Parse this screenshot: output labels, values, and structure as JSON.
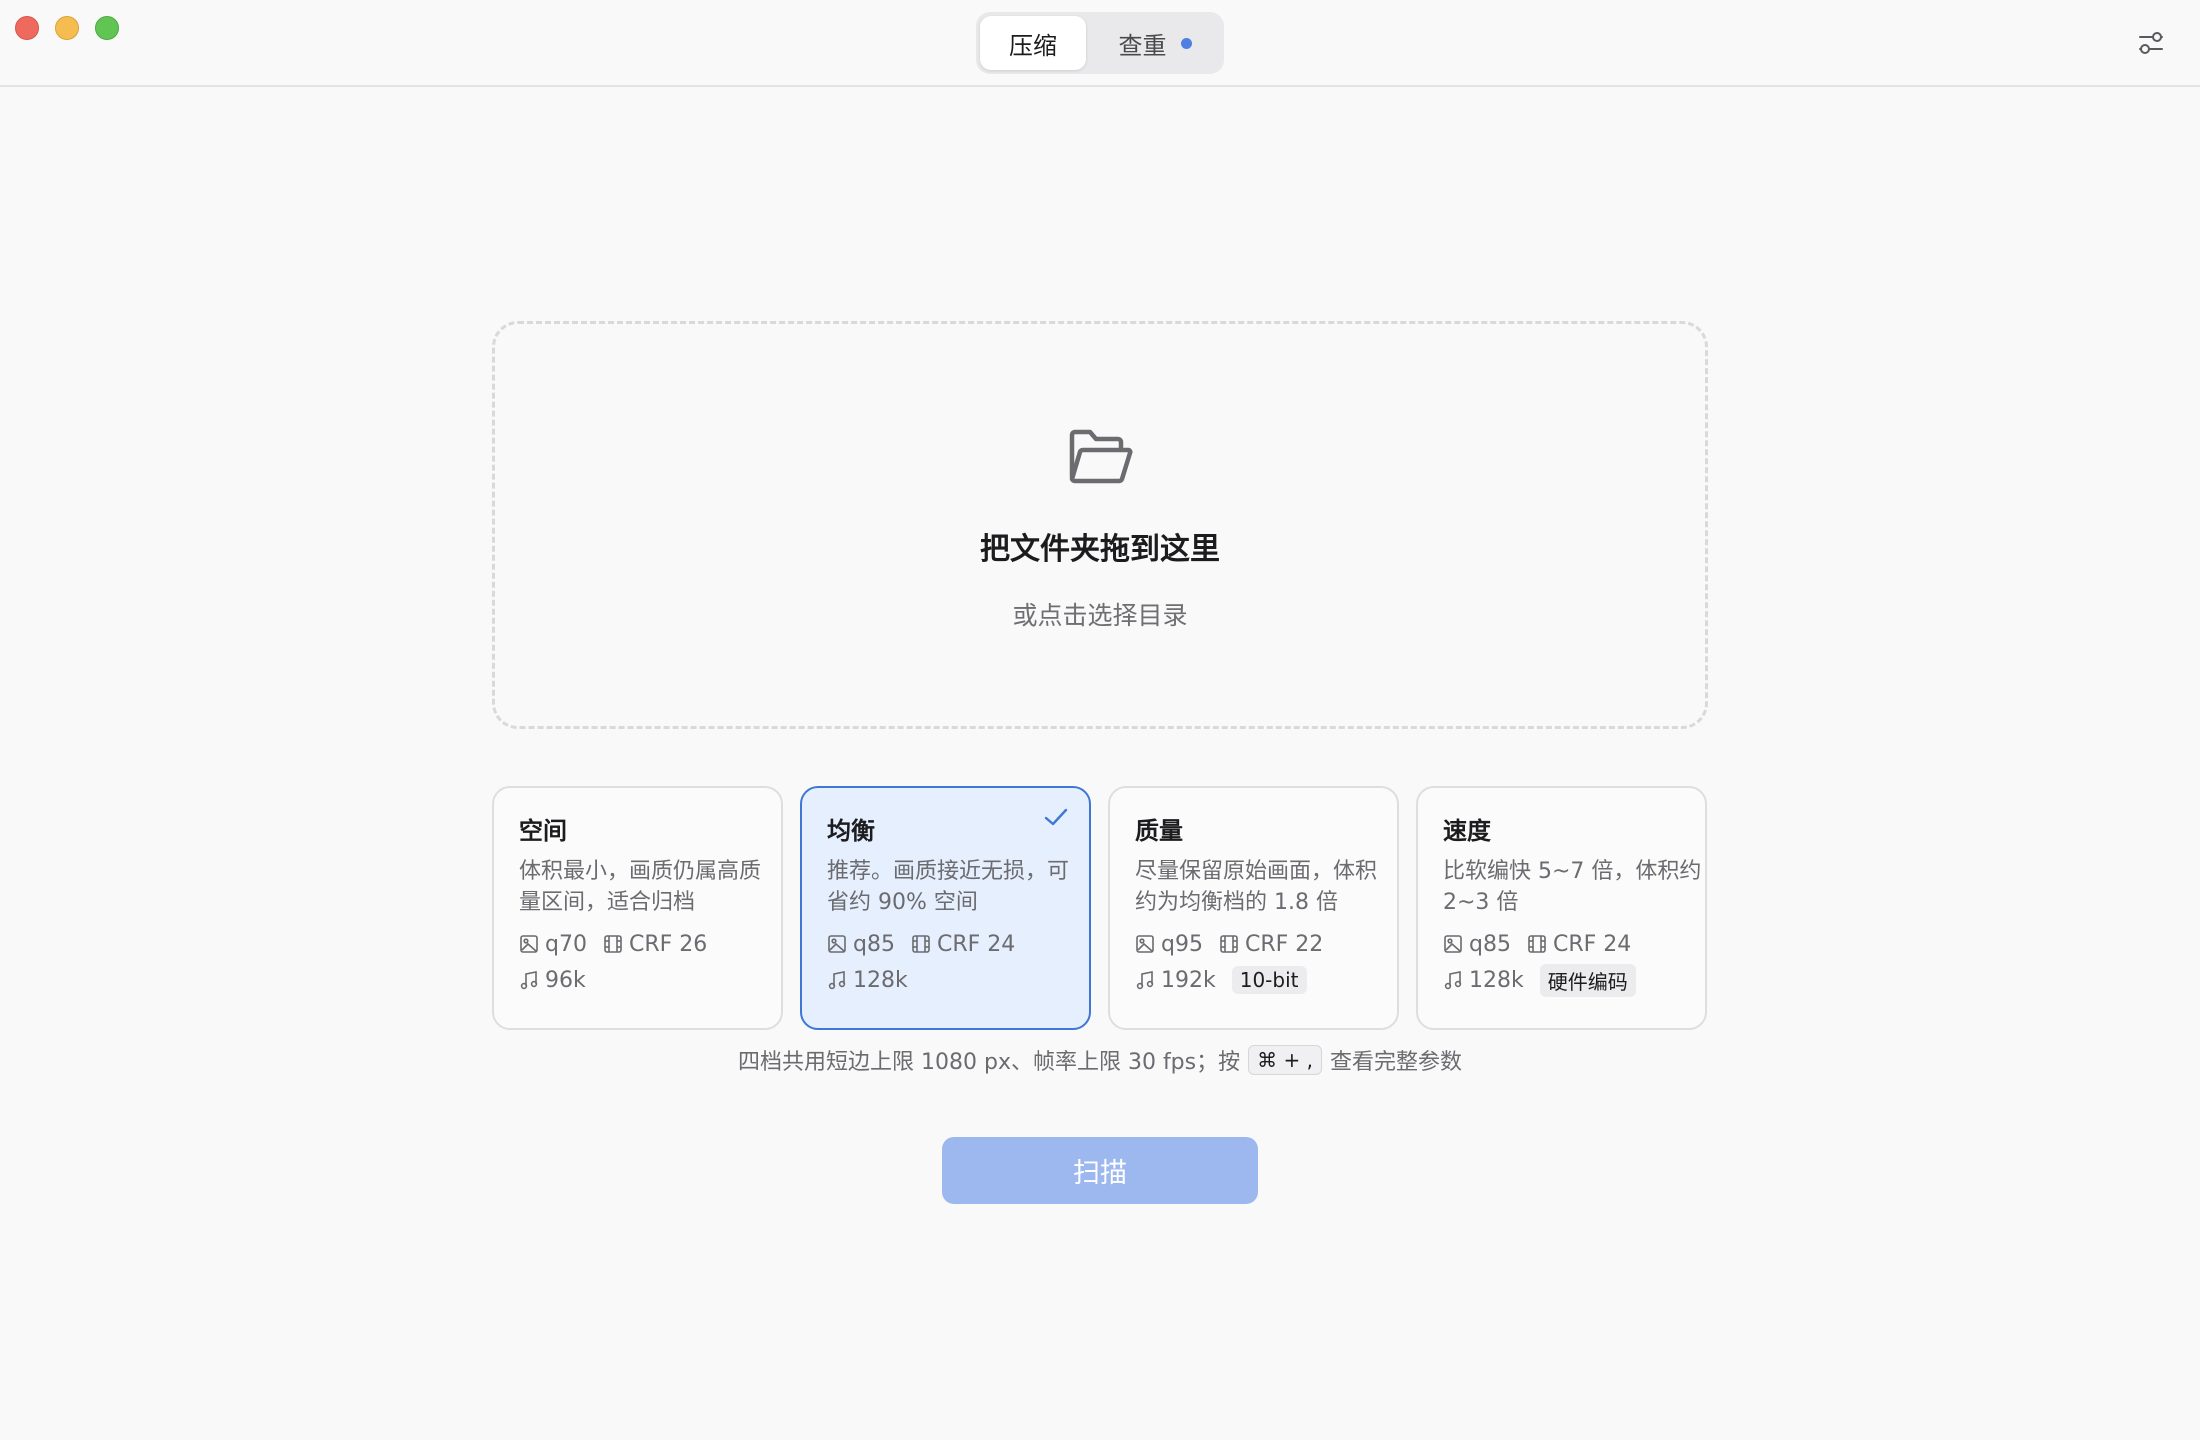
{
  "titlebar": {
    "tabs": [
      {
        "label": "压缩",
        "active": true
      },
      {
        "label": "查重",
        "active": false,
        "has_dot": true
      }
    ],
    "settings_icon": "sliders-icon"
  },
  "dropzone": {
    "icon": "folder-open-icon",
    "title": "把文件夹拖到这里",
    "subtitle": "或点击选择目录"
  },
  "presets": [
    {
      "title": "空间",
      "desc": "体积最小，画质仍属高质量区间，适合归档",
      "image": "q70",
      "video": "CRF 26",
      "audio": "96k",
      "tag": "",
      "selected": false
    },
    {
      "title": "均衡",
      "desc": "推荐。画质接近无损，可省约 90% 空间",
      "image": "q85",
      "video": "CRF 24",
      "audio": "128k",
      "tag": "",
      "selected": true
    },
    {
      "title": "质量",
      "desc": "尽量保留原始画面，体积约为均衡档的 1.8 倍",
      "image": "q95",
      "video": "CRF 22",
      "audio": "192k",
      "tag": "10-bit",
      "selected": false
    },
    {
      "title": "速度",
      "desc": "比软编快 5~7 倍，体积约 2~3 倍",
      "image": "q85",
      "video": "CRF 24",
      "audio": "128k",
      "tag": "硬件编码",
      "selected": false
    }
  ],
  "hint": {
    "prefix": "四档共用短边上限 1080 px、帧率上限 30 fps；按",
    "shortcut": "⌘ + ,",
    "suffix": "查看完整参数"
  },
  "scan_button": {
    "label": "扫描",
    "color": "#9db8ee"
  }
}
